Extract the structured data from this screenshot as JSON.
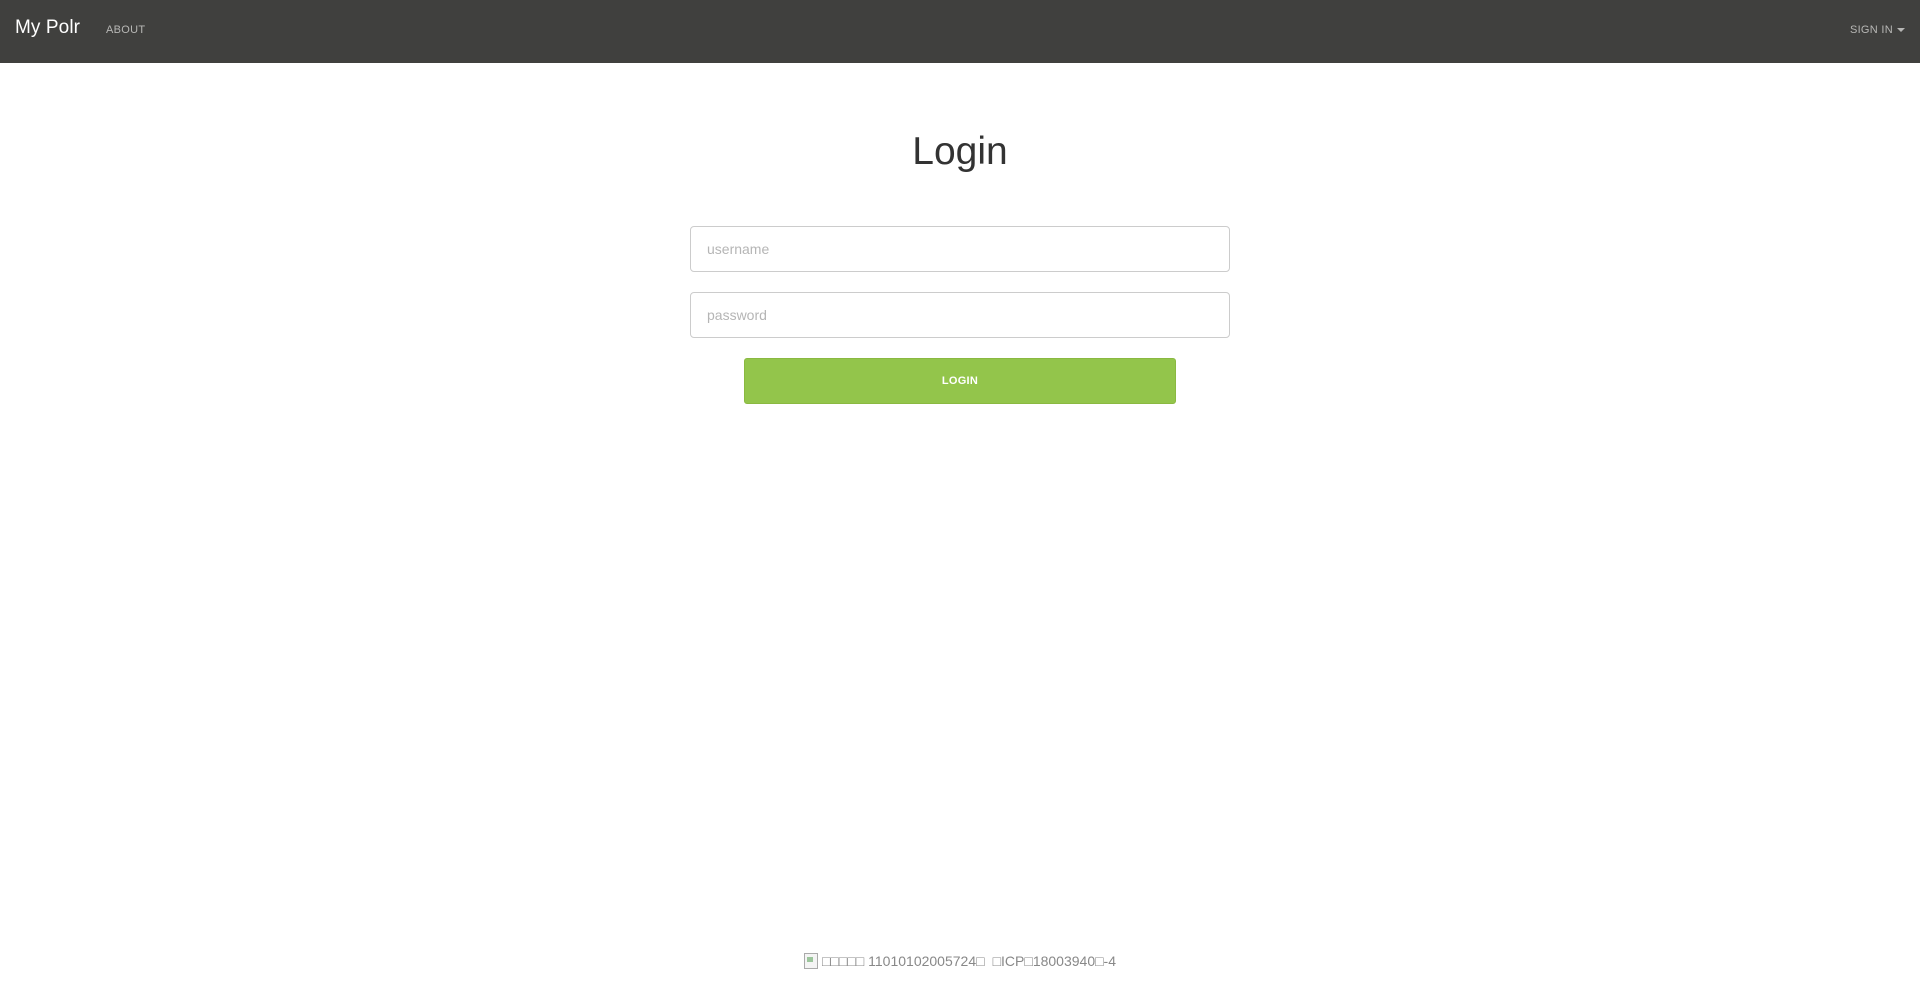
{
  "navbar": {
    "brand": "My Polr",
    "about_label": "ABOUT",
    "signin_label": "SIGN IN",
    "background_color": "#40403e"
  },
  "main": {
    "title": "Login",
    "username_placeholder": "username",
    "password_placeholder": "password",
    "login_button_label": "LOGIN",
    "accent_color": "#93c54b"
  },
  "footer": {
    "police_record": "□□□□□ 11010102005724□",
    "icp_record": "□ICP□18003940□-4"
  }
}
